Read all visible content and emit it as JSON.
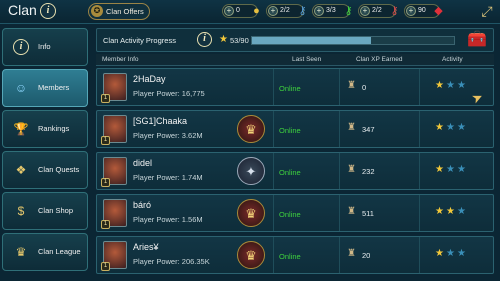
{
  "header": {
    "title": "Clan",
    "info_label": "i",
    "offers_label": "Clan Offers",
    "resources": [
      {
        "value": "0",
        "icon": "gold-coin-icon",
        "gem": "●"
      },
      {
        "value": "2/2",
        "icon": "key-icon",
        "gem": "⚷"
      },
      {
        "value": "3/3",
        "icon": "key-icon",
        "gem": "⚷"
      },
      {
        "value": "2/2",
        "icon": "key-icon",
        "gem": "⚷"
      },
      {
        "value": "90",
        "icon": "gem-icon",
        "gem": "◆"
      }
    ]
  },
  "sidebar": {
    "items": [
      {
        "label": "Info",
        "icon": "i"
      },
      {
        "label": "Members",
        "icon": "☺"
      },
      {
        "label": "Rankings",
        "icon": "🏆"
      },
      {
        "label": "Clan Quests",
        "icon": "❖"
      },
      {
        "label": "Clan Shop",
        "icon": "$"
      },
      {
        "label": "Clan League",
        "icon": "♛"
      }
    ]
  },
  "progress": {
    "label": "Clan Activity Progress",
    "value_text": "53/90",
    "current": 53,
    "max": 90
  },
  "table": {
    "headers": {
      "member_info": "Member Info",
      "last_seen": "Last Seen",
      "xp": "Clan XP Earned",
      "activity": "Activity"
    },
    "rows": [
      {
        "name": "2HaDay",
        "power": "Player Power: 16,775",
        "status": "Online",
        "xp": "0",
        "level": "1",
        "emblem": "",
        "stars": 1
      },
      {
        "name": "[SG1]Chaaka",
        "power": "Player Power: 3.62M",
        "status": "Online",
        "xp": "347",
        "level": "1",
        "emblem": "gold",
        "stars": 1
      },
      {
        "name": "didel",
        "power": "Player Power: 1.74M",
        "status": "Online",
        "xp": "232",
        "level": "1",
        "emblem": "silver",
        "stars": 1
      },
      {
        "name": "báró",
        "power": "Player Power: 1.56M",
        "status": "Online",
        "xp": "511",
        "level": "1",
        "emblem": "gold",
        "stars": 2
      },
      {
        "name": "Aries¥",
        "power": "Player Power: 206.35K",
        "status": "Online",
        "xp": "20",
        "level": "1",
        "emblem": "gold",
        "stars": 1
      }
    ]
  },
  "colors": {
    "online": "#3ed23e",
    "star_on": "#f2c83a",
    "star_off": "#3a8fb8"
  }
}
